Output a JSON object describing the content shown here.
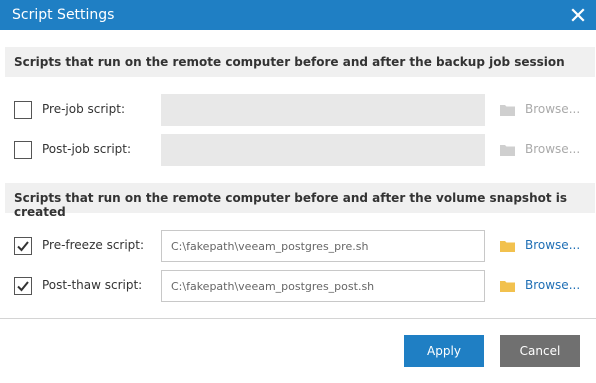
{
  "window": {
    "title": "Script Settings"
  },
  "sections": [
    {
      "header": "Scripts that run on the remote computer before and after the backup job session"
    },
    {
      "header": "Scripts that run on the remote computer before and after the volume snapshot is created"
    }
  ],
  "rows": {
    "pre_job": {
      "label": "Pre-job script:",
      "checked": false,
      "value": "",
      "browse": "Browse..."
    },
    "post_job": {
      "label": "Post-job script:",
      "checked": false,
      "value": "",
      "browse": "Browse..."
    },
    "pre_freeze": {
      "label": "Pre-freeze script:",
      "checked": true,
      "value": "C:\\fakepath\\veeam_postgres_pre.sh",
      "browse": "Browse..."
    },
    "post_thaw": {
      "label": "Post-thaw script:",
      "checked": true,
      "value": "C:\\fakepath\\veeam_postgres_post.sh",
      "browse": "Browse..."
    }
  },
  "buttons": {
    "apply": "Apply",
    "cancel": "Cancel"
  },
  "colors": {
    "accent": "#1f7fc4",
    "cancel": "#707070",
    "folder_enabled": "#f2c14e",
    "folder_disabled": "#cfcfcf",
    "link": "#1f6fb5"
  },
  "icons": {
    "close": "close-icon",
    "checkbox_check": "check-icon",
    "browse_folder": "folder-icon"
  }
}
